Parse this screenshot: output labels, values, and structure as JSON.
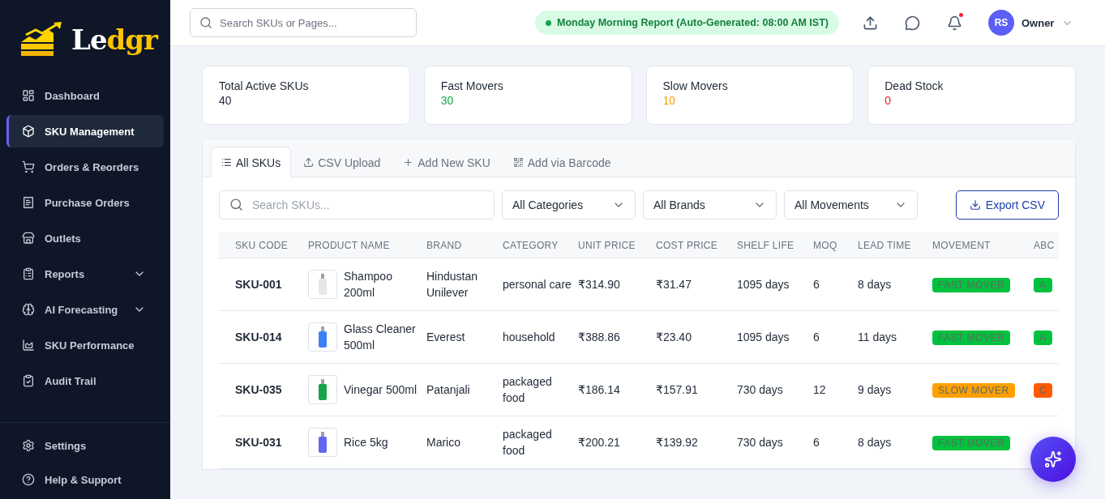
{
  "logo": {
    "text_light": "Le",
    "text_accent": "dgr"
  },
  "sidebar": {
    "items": [
      {
        "label": "Dashboard",
        "selected": false,
        "has_submenu": false
      },
      {
        "label": "SKU Management",
        "selected": true,
        "has_submenu": false
      },
      {
        "label": "Orders & Reorders",
        "selected": false,
        "has_submenu": false
      },
      {
        "label": "Purchase Orders",
        "selected": false,
        "has_submenu": false
      },
      {
        "label": "Outlets",
        "selected": false,
        "has_submenu": false
      },
      {
        "label": "Reports",
        "selected": false,
        "has_submenu": true
      },
      {
        "label": "AI Forecasting",
        "selected": false,
        "has_submenu": true
      },
      {
        "label": "SKU Performance",
        "selected": false,
        "has_submenu": false
      },
      {
        "label": "Audit Trail",
        "selected": false,
        "has_submenu": false
      }
    ],
    "footer_items": [
      {
        "label": "Settings"
      },
      {
        "label": "Help & Support"
      }
    ]
  },
  "header": {
    "search": {
      "placeholder": "Search SKUs or Pages..."
    },
    "report_pill": "Monday Morning Report (Auto-Generated: 08:00 AM IST)",
    "notifications_unread": true,
    "user": {
      "initials": "RS",
      "name": "Owner"
    }
  },
  "stats": [
    {
      "label": "Total Active SKUs",
      "value": "40",
      "color": "#1f2937"
    },
    {
      "label": "Fast Movers",
      "value": "30",
      "color": "#16a34a"
    },
    {
      "label": "Slow Movers",
      "value": "10",
      "color": "#f59e0b"
    },
    {
      "label": "Dead Stock",
      "value": "0",
      "color": "#dc2626"
    }
  ],
  "tabs": [
    {
      "label": "All SKUs",
      "selected": true
    },
    {
      "label": "CSV Upload",
      "selected": false
    },
    {
      "label": "Add New SKU",
      "selected": false
    },
    {
      "label": "Add via Barcode",
      "selected": false
    }
  ],
  "filters": {
    "search": {
      "placeholder": "Search SKUs..."
    },
    "selects": [
      "All Categories",
      "All Brands",
      "All Movements"
    ],
    "export_button": "Export CSV"
  },
  "table": {
    "columns": [
      "SKU CODE",
      "PRODUCT NAME",
      "BRAND",
      "CATEGORY",
      "UNIT PRICE",
      "COST PRICE",
      "SHELF LIFE",
      "MOQ",
      "LEAD TIME",
      "MOVEMENT",
      "ABC"
    ],
    "rows": [
      {
        "sku": "SKU-001",
        "product": "Shampoo 200ml",
        "brand": "Hindustan Unilever",
        "category": "personal care",
        "unit_price": "₹314.90",
        "cost_price": "₹31.47",
        "shelf_life": "1095 days",
        "moq": "6",
        "lead_time": "8 days",
        "movement": {
          "label": "FAST MOVER",
          "color": "#00c23f"
        },
        "abc": {
          "label": "A",
          "color": "#00c23f"
        }
      },
      {
        "sku": "SKU-014",
        "product": "Glass Cleaner 500ml",
        "brand": "Everest",
        "category": "household",
        "unit_price": "₹388.86",
        "cost_price": "₹23.40",
        "shelf_life": "1095 days",
        "moq": "6",
        "lead_time": "11 days",
        "movement": {
          "label": "FAST MOVER",
          "color": "#00c23f"
        },
        "abc": {
          "label": "A",
          "color": "#00c23f"
        }
      },
      {
        "sku": "SKU-035",
        "product": "Vinegar 500ml",
        "brand": "Patanjali",
        "category": "packaged food",
        "unit_price": "₹186.14",
        "cost_price": "₹157.91",
        "shelf_life": "730 days",
        "moq": "12",
        "lead_time": "9 days",
        "movement": {
          "label": "SLOW MOVER",
          "color": "#ffa000"
        },
        "abc": {
          "label": "C",
          "color": "#ff5a00"
        }
      },
      {
        "sku": "SKU-031",
        "product": "Rice 5kg",
        "brand": "Marico",
        "category": "packaged food",
        "unit_price": "₹200.21",
        "cost_price": "₹139.92",
        "shelf_life": "730 days",
        "moq": "6",
        "lead_time": "8 days",
        "movement": {
          "label": "FAST MOVER",
          "color": "#00c23f"
        }
      }
    ]
  }
}
